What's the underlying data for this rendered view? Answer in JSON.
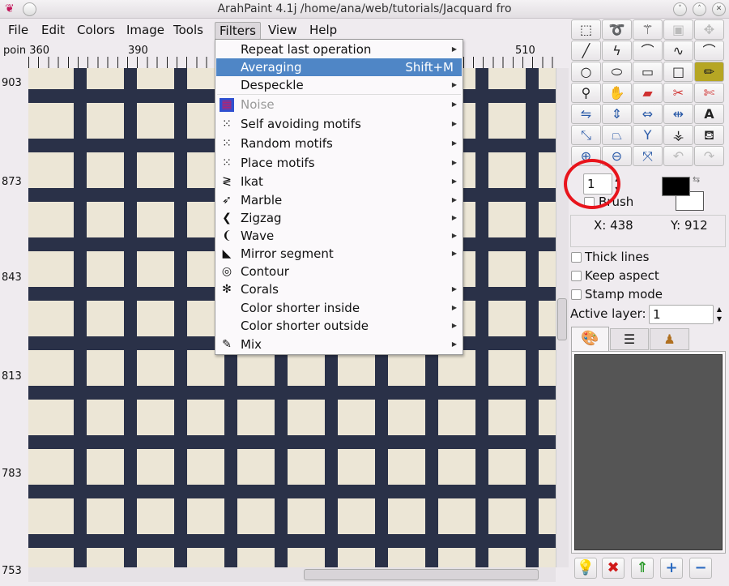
{
  "window": {
    "title": "ArahPaint 4.1j /home/ana/web/tutorials/Jacquard fro"
  },
  "menubar": [
    "File",
    "Edit",
    "Colors",
    "Image",
    "Tools",
    "Filters",
    "View",
    "Help"
  ],
  "ruler": {
    "h": [
      "poin 360",
      "390",
      "510"
    ],
    "v": [
      "903",
      "873",
      "843",
      "813",
      "783",
      "753"
    ]
  },
  "filters_menu": [
    {
      "label": "Repeat last operation",
      "submenu": true
    },
    {
      "label": "Averaging",
      "shortcut": "Shift+M",
      "highlighted": true
    },
    {
      "label": "Despeckle",
      "submenu": true
    },
    {
      "label": "Noise",
      "submenu": true,
      "disabled": true,
      "icon": "noise-icon"
    },
    {
      "label": "Self avoiding motifs",
      "submenu": true,
      "icon": "dots-icon"
    },
    {
      "label": "Random motifs",
      "submenu": true,
      "icon": "dots-icon"
    },
    {
      "label": "Place motifs",
      "submenu": true,
      "icon": "dots-icon"
    },
    {
      "label": "Ikat",
      "submenu": true,
      "icon": "ikat-icon"
    },
    {
      "label": "Marble",
      "submenu": true,
      "icon": "marble-icon"
    },
    {
      "label": "Zigzag",
      "submenu": true,
      "icon": "zigzag-icon"
    },
    {
      "label": "Wave",
      "submenu": true,
      "icon": "wave-icon"
    },
    {
      "label": "Mirror segment",
      "submenu": true,
      "icon": "mirror-icon"
    },
    {
      "label": "Contour",
      "submenu": false,
      "icon": "contour-icon"
    },
    {
      "label": "Corals",
      "submenu": true,
      "icon": "corals-icon"
    },
    {
      "label": "Color shorter inside",
      "submenu": true
    },
    {
      "label": "Color shorter outside",
      "submenu": true
    },
    {
      "label": "Mix",
      "submenu": true,
      "icon": "mix-icon"
    }
  ],
  "tools": [
    [
      "select-rect",
      "lasso",
      "magic-wand",
      "crop",
      "move"
    ],
    [
      "line",
      "polyline",
      "curve",
      "freehand-points",
      "bezier"
    ],
    [
      "circle",
      "ellipse",
      "rectangle",
      "square",
      "pencil"
    ],
    [
      "color-picker",
      "smudge",
      "eraser",
      "cut",
      "cut-dotted"
    ],
    [
      "flip",
      "flip-vertical",
      "flip-horizontal",
      "mirror",
      "text"
    ],
    [
      "resize",
      "perspective",
      "split",
      "compass",
      "fill"
    ],
    [
      "zoom-in",
      "zoom-out",
      "fit",
      "undo",
      "redo"
    ]
  ],
  "panel": {
    "brush_size": "1",
    "brush_label": "Brush",
    "x_label": "X: 438",
    "y_label": "Y: 912",
    "options": [
      "Thick lines",
      "Keep aspect",
      "Stamp mode"
    ],
    "active_layer_label": "Active layer:",
    "active_layer": "1",
    "fg_color": "#000000",
    "bg_color": "#ffffff"
  },
  "annotation_color": "#e8141c"
}
